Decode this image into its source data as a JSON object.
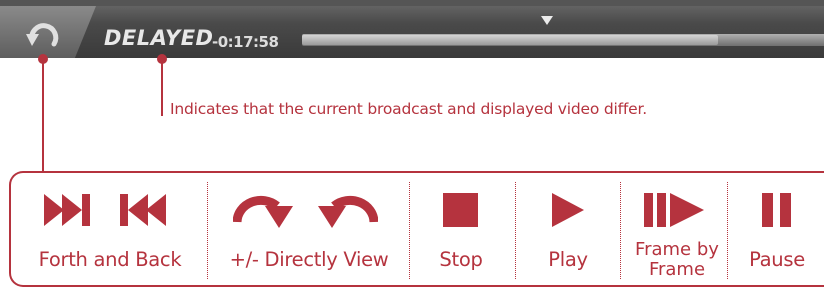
{
  "status_bar": {
    "mode_label": "DELAYED",
    "offset_time": "-0:17:58",
    "progress_fraction": 0.77
  },
  "callout": {
    "text": "Indicates that the current broadcast and displayed video differ."
  },
  "legend": {
    "items": [
      {
        "label": "Forth and Back"
      },
      {
        "label": "+/- Directly View"
      },
      {
        "label": "Stop"
      },
      {
        "label": "Play"
      },
      {
        "label_line1": "Frame by",
        "label_line2": "Frame"
      },
      {
        "label": "Pause"
      }
    ]
  },
  "colors": {
    "accent": "#b5333e",
    "icon_fill": "#b5333e",
    "bar_dark": "#3a3a3a"
  },
  "icons": [
    "back-arrow-icon",
    "skip-forward-icon",
    "skip-back-icon",
    "rotate-clockwise-icon",
    "rotate-counterclockwise-icon",
    "stop-icon",
    "play-icon",
    "frame-step-icon",
    "pause-icon"
  ]
}
